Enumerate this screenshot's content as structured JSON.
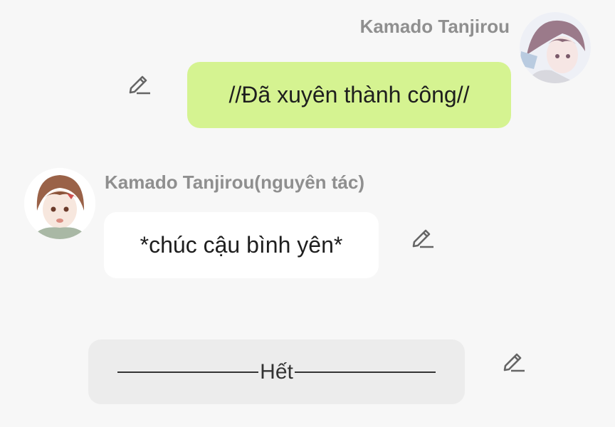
{
  "messages": [
    {
      "sender": "Kamado Tanjirou",
      "text": "//Đã xuyên thành công//"
    },
    {
      "sender": "Kamado Tanjirou(nguyên tác)",
      "text": "*chúc cậu bình yên*"
    }
  ],
  "end_marker": {
    "text": "Hết"
  },
  "icons": {
    "edit": "pencil-edit-icon",
    "avatar_right": "tanjirou-avatar",
    "avatar_left": "tanjirou-original-avatar"
  },
  "colors": {
    "background": "#f7f7f7",
    "bubble_green": "#d5f391",
    "bubble_white": "#ffffff",
    "bubble_grey": "#ececec",
    "name_text": "#8f8f8f"
  }
}
